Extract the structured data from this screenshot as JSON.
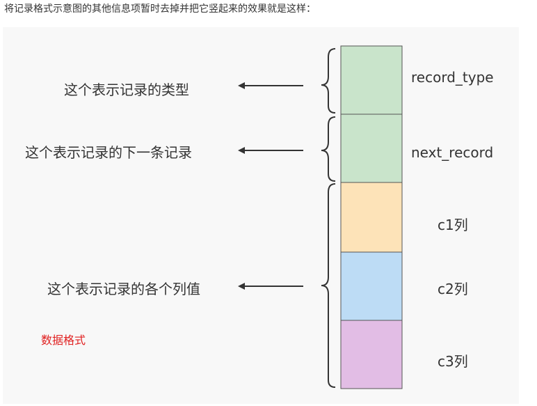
{
  "intro_text": "将记录格式示意图的其他信息项暂时去掉并把它竖起来的效果就是这样：",
  "descriptions": {
    "record_type": "这个表示记录的类型",
    "next_record": "这个表示记录的下一条记录",
    "columns": "这个表示记录的各个列值"
  },
  "fields": [
    {
      "label": "record_type",
      "color": "#c9e4cb"
    },
    {
      "label": "next_record",
      "color": "#c9e4cb"
    },
    {
      "label": "c1列",
      "color": "#fde3b8"
    },
    {
      "label": "c2列",
      "color": "#bddcf5"
    },
    {
      "label": "c3列",
      "color": "#e2bde5"
    }
  ],
  "note": "数据格式",
  "colors": {
    "border": "#555555",
    "arrow": "#333333",
    "note": "#e02020"
  }
}
